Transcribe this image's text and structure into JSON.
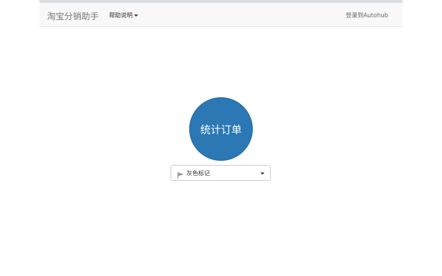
{
  "navbar": {
    "brand": "淘宝分销助手",
    "help_menu_label": "帮助说明",
    "login_link": "登录到Autohub"
  },
  "main": {
    "count_button_label": "统计订单",
    "mark_select": {
      "selected": "灰色标记",
      "icon": "flag-icon"
    }
  },
  "colors": {
    "button_blue": "#2b78b5",
    "navbar_bg": "#f8f8f8",
    "flag_gray": "#999999"
  }
}
